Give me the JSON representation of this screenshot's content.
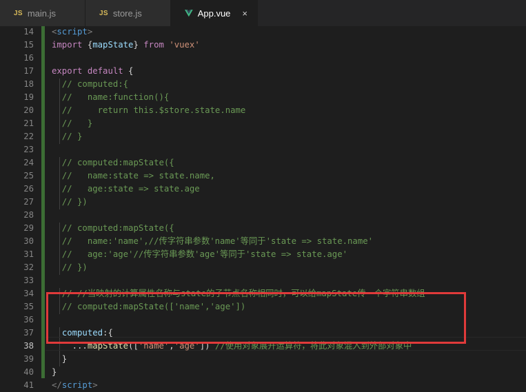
{
  "tabs": [
    {
      "icon": "JS",
      "label": "main.js",
      "active": false
    },
    {
      "icon": "JS",
      "label": "store.js",
      "active": false
    },
    {
      "icon": "vue-icon",
      "label": "App.vue",
      "active": true,
      "close": "×"
    }
  ],
  "colors": {
    "keyword_blue": "#569cd6",
    "keyword_purple": "#c586c0",
    "string": "#ce9178",
    "comment": "#6a9955",
    "function": "#dcdcaa",
    "variable": "#9cdcfe",
    "highlight_border": "#e03a3a",
    "modified_gutter": "#3c6d34"
  },
  "lines": [
    {
      "n": "14",
      "segs": [
        [
          "tagb",
          "<"
        ],
        [
          "tag",
          "script"
        ],
        [
          "tagb",
          ">"
        ]
      ]
    },
    {
      "n": "15",
      "segs": [
        [
          "kw-purple",
          "import"
        ],
        [
          "pn",
          " {"
        ],
        [
          "var",
          "mapState"
        ],
        [
          "pn",
          "} "
        ],
        [
          "kw-purple",
          "from"
        ],
        [
          "pn",
          " "
        ],
        [
          "str",
          "'vuex'"
        ]
      ]
    },
    {
      "n": "16",
      "segs": []
    },
    {
      "n": "17",
      "segs": [
        [
          "kw-purple",
          "export"
        ],
        [
          "pn",
          " "
        ],
        [
          "kw-purple",
          "default"
        ],
        [
          "pn",
          " {"
        ]
      ]
    },
    {
      "n": "18",
      "segs": [
        [
          "cm",
          "  // computed:{"
        ]
      ]
    },
    {
      "n": "19",
      "segs": [
        [
          "cm",
          "  //   name:function(){"
        ]
      ]
    },
    {
      "n": "20",
      "segs": [
        [
          "cm",
          "  //     return this.$store.state.name"
        ]
      ]
    },
    {
      "n": "21",
      "segs": [
        [
          "cm",
          "  //   }"
        ]
      ]
    },
    {
      "n": "22",
      "segs": [
        [
          "cm",
          "  // }"
        ]
      ]
    },
    {
      "n": "23",
      "segs": []
    },
    {
      "n": "24",
      "segs": [
        [
          "cm",
          "  // computed:mapState({"
        ]
      ]
    },
    {
      "n": "25",
      "segs": [
        [
          "cm",
          "  //   name:state => state.name,"
        ]
      ]
    },
    {
      "n": "26",
      "segs": [
        [
          "cm",
          "  //   age:state => state.age"
        ]
      ]
    },
    {
      "n": "27",
      "segs": [
        [
          "cm",
          "  // })"
        ]
      ]
    },
    {
      "n": "28",
      "segs": []
    },
    {
      "n": "29",
      "segs": [
        [
          "cm",
          "  // computed:mapState({"
        ]
      ]
    },
    {
      "n": "30",
      "segs": [
        [
          "cm",
          "  //   name:'name',//传字符串参数'name'等同于'state => state.name'"
        ]
      ]
    },
    {
      "n": "31",
      "segs": [
        [
          "cm",
          "  //   age:'age'//传字符串参数'age'等同于'state => state.age'"
        ]
      ]
    },
    {
      "n": "32",
      "segs": [
        [
          "cm",
          "  // })"
        ]
      ]
    },
    {
      "n": "33",
      "segs": []
    },
    {
      "n": "34",
      "segs": [
        [
          "cm",
          "  // //当映射的计算属性名称与state的子节点名称相同时，可以给mapState传一个字符串数组"
        ]
      ]
    },
    {
      "n": "35",
      "segs": [
        [
          "cm",
          "  // computed:mapState(['name','age'])"
        ]
      ]
    },
    {
      "n": "36",
      "segs": []
    },
    {
      "n": "37",
      "segs": [
        [
          "pn",
          "  "
        ],
        [
          "var",
          "computed"
        ],
        [
          "pn",
          ":{"
        ]
      ]
    },
    {
      "n": "38",
      "segs": [
        [
          "pn",
          "    ..."
        ],
        [
          "fn",
          "mapState"
        ],
        [
          "pn",
          "(["
        ],
        [
          "str",
          "'name'"
        ],
        [
          "pn",
          ","
        ],
        [
          "str",
          "'age'"
        ],
        [
          "pn",
          "]) "
        ],
        [
          "cm",
          "//使用对象展开运算符，将此对象混入到外部对象中"
        ]
      ]
    },
    {
      "n": "39",
      "segs": [
        [
          "pn",
          "  }"
        ]
      ]
    },
    {
      "n": "40",
      "segs": [
        [
          "pn",
          "}"
        ]
      ]
    },
    {
      "n": "41",
      "segs": [
        [
          "tagb",
          "</"
        ],
        [
          "tag",
          "script"
        ],
        [
          "tagb",
          ">"
        ]
      ]
    }
  ]
}
